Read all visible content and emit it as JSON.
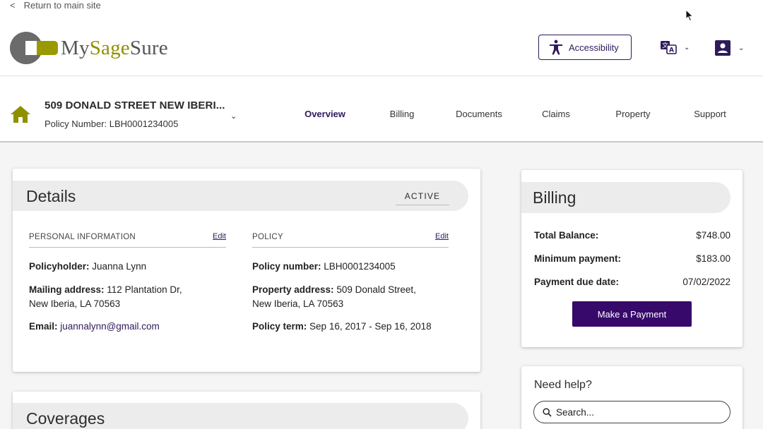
{
  "top": {
    "return_chevron": "<",
    "return_label": "Return to main site"
  },
  "logo": {
    "part_my": "My",
    "part_sage": "Sage",
    "part_sure": "Sure"
  },
  "header": {
    "accessibility_label": "Accessibility",
    "language_icon": "translate-icon",
    "account_icon": "account-box-icon"
  },
  "policy": {
    "address_title": "509 DONALD STREET NEW IBERI...",
    "policy_number_line": "Policy Number: LBH0001234005"
  },
  "nav": {
    "tabs": [
      {
        "label": "Overview",
        "active": true
      },
      {
        "label": "Billing",
        "active": false
      },
      {
        "label": "Documents",
        "active": false
      },
      {
        "label": "Claims",
        "active": false
      },
      {
        "label": "Property",
        "active": false
      },
      {
        "label": "Support",
        "active": false
      }
    ]
  },
  "details": {
    "title": "Details",
    "status": "ACTIVE",
    "personal": {
      "heading": "PERSONAL INFORMATION",
      "edit": "Edit",
      "policyholder_label": "Policyholder:",
      "policyholder_value": "Juanna Lynn",
      "mailing_label": "Mailing address:",
      "mailing_line1": "112 Plantation Dr,",
      "mailing_line2": "New Iberia, LA 70563",
      "email_label": "Email:",
      "email_value": "juannalynn@gmail.com"
    },
    "policy": {
      "heading": "POLICY",
      "edit": "Edit",
      "number_label": "Policy number:",
      "number_value": "LBH0001234005",
      "property_label": "Property address:",
      "property_line1": "509 Donald Street,",
      "property_line2": "New Iberia, LA 70563",
      "term_label": "Policy term:",
      "term_value": "Sep 16, 2017 - Sep 16, 2018"
    }
  },
  "coverages": {
    "title": "Coverages"
  },
  "billing": {
    "title": "Billing",
    "rows": [
      {
        "label": "Total Balance:",
        "value": "$748.00"
      },
      {
        "label": "Minimum payment:",
        "value": "$183.00"
      },
      {
        "label": "Payment due date:",
        "value": "07/02/2022"
      }
    ],
    "pay_button": "Make a Payment"
  },
  "help": {
    "title": "Need help?",
    "search_placeholder": "Search..."
  },
  "colors": {
    "brand_purple": "#2e1a5c",
    "button_purple": "#36096b",
    "brand_olive": "#8f9000",
    "logo_grey": "#6b6b6b"
  }
}
